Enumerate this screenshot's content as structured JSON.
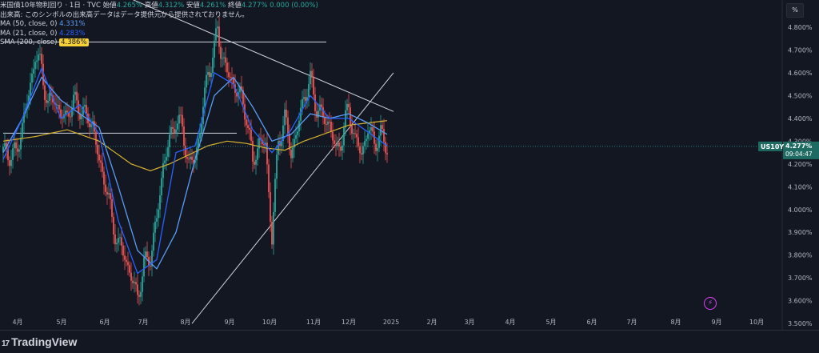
{
  "legend": {
    "title": "米国債10年物利回り · 1日 · TVC",
    "open_label": "始値",
    "open": "4.265%",
    "high_label": "高値",
    "high": "4.312%",
    "low_label": "安値",
    "low": "4.261%",
    "close_label": "終値",
    "close": "4.277%",
    "change": "0.000 (0.00%)",
    "volume_note": "出来高: このシンボルの出来高データはデータ提供元から提供されておりません。",
    "ma1_label": "MA (50, close, 0)",
    "ma1_value": "4.331%",
    "ma2_label": "MA (21, close, 0)",
    "ma2_value": "4.283%",
    "ma3_label": "SMA (200, close)",
    "ma3_value": "4.386%"
  },
  "pct_button": "%",
  "brand": {
    "logo": "17",
    "name": "TradingView"
  },
  "price_tag": {
    "symbol": "US10Y",
    "price": "4.277%",
    "countdown": "09:04:47"
  },
  "colors": {
    "up": "#26a69a",
    "down": "#ef5350",
    "ma50": "#5b9cf6",
    "ma21": "#2962ff",
    "sma200": "#d4b130",
    "line": "#d1d4dc"
  },
  "chart_data": {
    "type": "candlestick",
    "x_labels": [
      "4月",
      "5月",
      "6月",
      "7月",
      "8月",
      "9月",
      "10月",
      "11月",
      "12月",
      "2025",
      "2月",
      "3月",
      "4月",
      "5月",
      "6月",
      "7月",
      "8月",
      "9月",
      "10月"
    ],
    "y_ticks": [
      "4.800%",
      "4.700%",
      "4.600%",
      "4.500%",
      "4.400%",
      "4.300%",
      "4.200%",
      "4.100%",
      "4.000%",
      "3.900%",
      "3.800%",
      "3.700%",
      "3.600%",
      "3.500%"
    ],
    "ylim": [
      3.49,
      4.87
    ],
    "close_path": [
      [
        0,
        4.25
      ],
      [
        4,
        4.24
      ],
      [
        8,
        4.5
      ],
      [
        10,
        4.68
      ],
      [
        12,
        4.62
      ],
      [
        14,
        4.45
      ],
      [
        16,
        4.5
      ],
      [
        18,
        4.4
      ],
      [
        20,
        4.42
      ],
      [
        22,
        4.47
      ],
      [
        24,
        4.45
      ],
      [
        26,
        4.4
      ],
      [
        28,
        4.38
      ],
      [
        30,
        4.2
      ],
      [
        32,
        4.12
      ],
      [
        34,
        3.95
      ],
      [
        36,
        3.85
      ],
      [
        38,
        3.8
      ],
      [
        40,
        3.7
      ],
      [
        42,
        3.62
      ],
      [
        44,
        3.75
      ],
      [
        46,
        3.8
      ],
      [
        48,
        3.95
      ],
      [
        50,
        4.2
      ],
      [
        52,
        4.3
      ],
      [
        54,
        4.4
      ],
      [
        56,
        4.35
      ],
      [
        58,
        4.2
      ],
      [
        60,
        4.22
      ],
      [
        62,
        4.4
      ],
      [
        64,
        4.6
      ],
      [
        66,
        4.7
      ],
      [
        67,
        4.79
      ],
      [
        68,
        4.7
      ],
      [
        70,
        4.6
      ],
      [
        72,
        4.55
      ],
      [
        74,
        4.5
      ],
      [
        76,
        4.42
      ],
      [
        78,
        4.2
      ],
      [
        80,
        4.3
      ],
      [
        82,
        4.28
      ],
      [
        84,
        3.88
      ],
      [
        86,
        4.3
      ],
      [
        88,
        4.4
      ],
      [
        90,
        4.25
      ],
      [
        92,
        4.35
      ],
      [
        94,
        4.5
      ],
      [
        96,
        4.56
      ],
      [
        98,
        4.45
      ],
      [
        100,
        4.4
      ],
      [
        102,
        4.38
      ],
      [
        104,
        4.25
      ],
      [
        106,
        4.32
      ],
      [
        108,
        4.45
      ],
      [
        110,
        4.3
      ],
      [
        112,
        4.25
      ],
      [
        114,
        4.35
      ],
      [
        116,
        4.3
      ],
      [
        118,
        4.32
      ],
      [
        120,
        4.28
      ]
    ],
    "ma50_path": [
      [
        0,
        4.25
      ],
      [
        6,
        4.4
      ],
      [
        12,
        4.58
      ],
      [
        18,
        4.48
      ],
      [
        24,
        4.42
      ],
      [
        30,
        4.36
      ],
      [
        36,
        4.1
      ],
      [
        42,
        3.82
      ],
      [
        48,
        3.74
      ],
      [
        54,
        3.9
      ],
      [
        60,
        4.22
      ],
      [
        66,
        4.5
      ],
      [
        72,
        4.58
      ],
      [
        78,
        4.45
      ],
      [
        84,
        4.3
      ],
      [
        90,
        4.33
      ],
      [
        96,
        4.42
      ],
      [
        102,
        4.4
      ],
      [
        108,
        4.42
      ],
      [
        114,
        4.38
      ],
      [
        120,
        4.33
      ]
    ],
    "ma21_path": [
      [
        0,
        4.22
      ],
      [
        6,
        4.4
      ],
      [
        12,
        4.62
      ],
      [
        18,
        4.4
      ],
      [
        24,
        4.46
      ],
      [
        30,
        4.33
      ],
      [
        36,
        3.95
      ],
      [
        42,
        3.72
      ],
      [
        48,
        3.78
      ],
      [
        54,
        4.25
      ],
      [
        60,
        4.28
      ],
      [
        66,
        4.6
      ],
      [
        72,
        4.55
      ],
      [
        78,
        4.35
      ],
      [
        84,
        4.25
      ],
      [
        90,
        4.35
      ],
      [
        96,
        4.5
      ],
      [
        102,
        4.4
      ],
      [
        108,
        4.4
      ],
      [
        114,
        4.34
      ],
      [
        120,
        4.28
      ]
    ],
    "sma200_path": [
      [
        0,
        4.3
      ],
      [
        10,
        4.32
      ],
      [
        20,
        4.35
      ],
      [
        30,
        4.3
      ],
      [
        40,
        4.2
      ],
      [
        46,
        4.17
      ],
      [
        52,
        4.2
      ],
      [
        58,
        4.24
      ],
      [
        64,
        4.28
      ],
      [
        70,
        4.3
      ],
      [
        76,
        4.29
      ],
      [
        82,
        4.27
      ],
      [
        88,
        4.26
      ],
      [
        94,
        4.3
      ],
      [
        100,
        4.33
      ],
      [
        108,
        4.37
      ],
      [
        114,
        4.38
      ],
      [
        120,
        4.39
      ]
    ],
    "hlines": [
      {
        "y": 4.735,
        "x_from": 0,
        "x_to": 101
      },
      {
        "y": 4.335,
        "x_from": 0,
        "x_to": 73
      }
    ],
    "trendlines": [
      {
        "from": [
          29,
          4.99
        ],
        "to": [
          122,
          4.43
        ]
      },
      {
        "from": [
          59,
          3.5
        ],
        "to": [
          122,
          4.6
        ]
      }
    ],
    "last_price": 4.277
  }
}
